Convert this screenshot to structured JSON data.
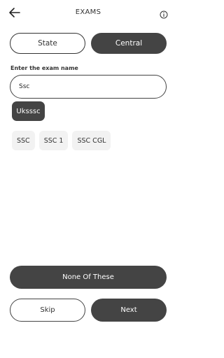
{
  "header": {
    "title": "EXAMS",
    "back_icon": "arrow-left-icon",
    "info_icon": "info-circle-icon"
  },
  "toggle": {
    "options": [
      {
        "label": "State",
        "selected": false
      },
      {
        "label": "Central",
        "selected": true
      }
    ]
  },
  "search": {
    "label": "Enter the exam name",
    "value": "Ssc"
  },
  "suggestion": {
    "label": "Uksssc"
  },
  "chips": [
    {
      "label": "SSC"
    },
    {
      "label": "SSC 1"
    },
    {
      "label": "SSC CGL"
    }
  ],
  "actions": {
    "none_label": "None Of These",
    "skip_label": "Skip",
    "next_label": "Next"
  },
  "colors": {
    "primary_dark": "#444444",
    "chip_bg": "#f2f2f2"
  }
}
